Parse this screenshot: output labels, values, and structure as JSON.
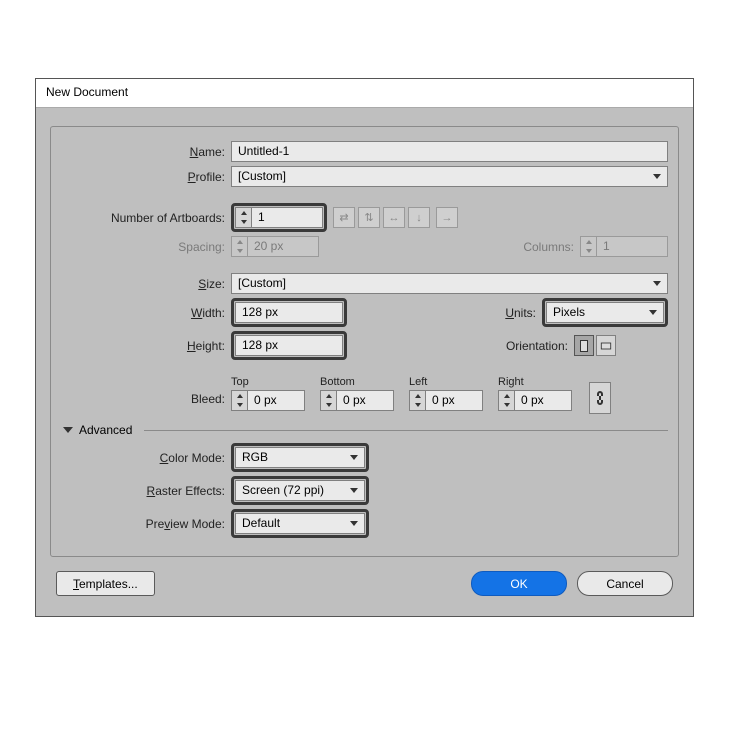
{
  "title": "New Document",
  "labels": {
    "name": "Name:",
    "profile": "Profile:",
    "artboards": "Number of Artboards:",
    "spacing": "Spacing:",
    "columns": "Columns:",
    "size": "Size:",
    "width": "Width:",
    "height": "Height:",
    "units": "Units:",
    "orientation": "Orientation:",
    "bleed": "Bleed:",
    "bleedTop": "Top",
    "bleedBottom": "Bottom",
    "bleedLeft": "Left",
    "bleedRight": "Right",
    "advanced": "Advanced",
    "colorMode": "Color Mode:",
    "raster": "Raster Effects:",
    "preview": "Preview Mode:"
  },
  "mnemonics": {
    "name": "N",
    "profile": "P",
    "size": "S",
    "width": "W",
    "height": "H",
    "units": "U",
    "colorMode": "C",
    "raster": "R",
    "preview": "P",
    "templates": "T"
  },
  "values": {
    "name": "Untitled-1",
    "profile": "[Custom]",
    "artboards": "1",
    "spacing": "20 px",
    "columns": "1",
    "size": "[Custom]",
    "width": "128 px",
    "height": "128 px",
    "units": "Pixels",
    "bleed": {
      "top": "0 px",
      "bottom": "0 px",
      "left": "0 px",
      "right": "0 px"
    },
    "colorMode": "RGB",
    "raster": "Screen (72 ppi)",
    "preview": "Default"
  },
  "buttons": {
    "templates": "Templates...",
    "ok": "OK",
    "cancel": "Cancel"
  }
}
